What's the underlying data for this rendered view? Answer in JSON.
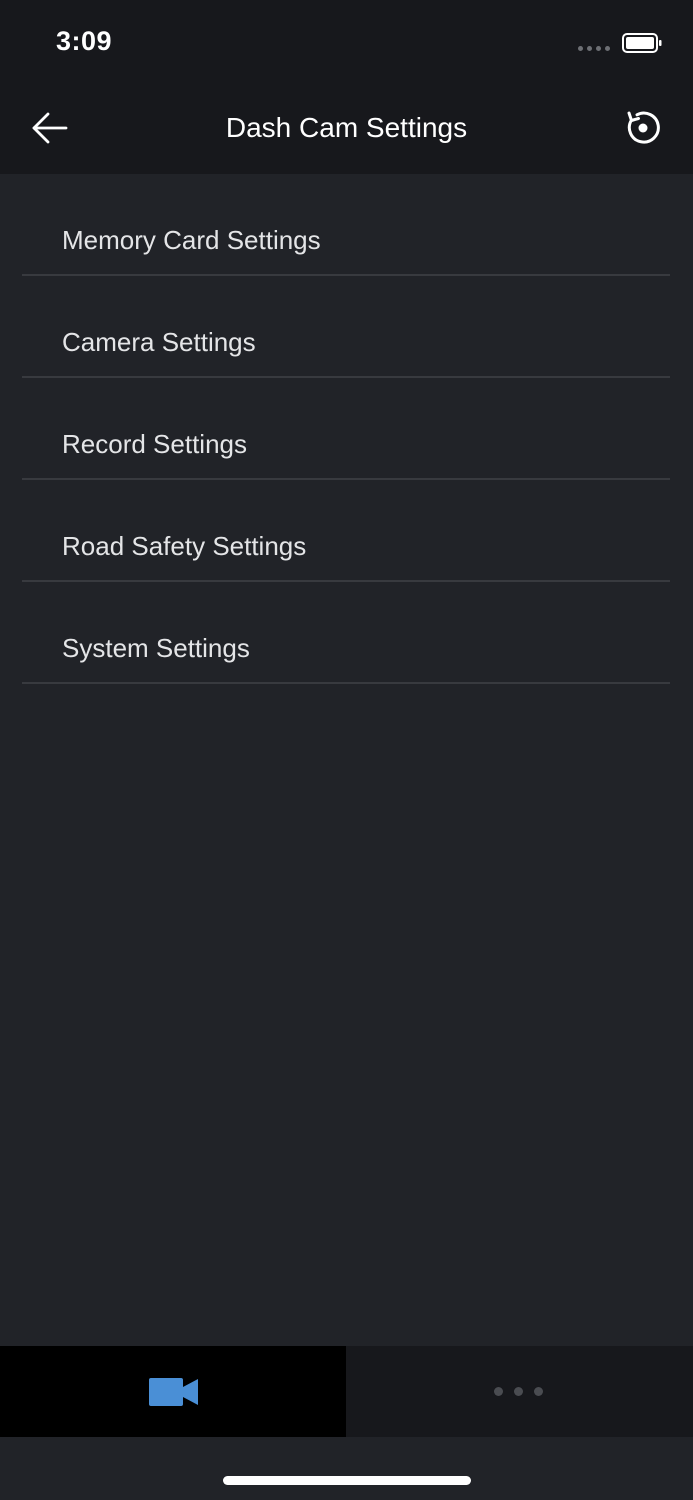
{
  "status_bar": {
    "time": "3:09"
  },
  "nav": {
    "title": "Dash Cam Settings",
    "back_icon": "arrow-left-icon",
    "reset_icon": "reset-circle-icon"
  },
  "settings": {
    "items": [
      {
        "label": "Memory Card Settings"
      },
      {
        "label": "Camera Settings"
      },
      {
        "label": "Record Settings"
      },
      {
        "label": "Road Safety Settings"
      },
      {
        "label": "System Settings"
      }
    ]
  },
  "tabs": {
    "dashcam_icon": "video-camera-icon",
    "more_icon": "more-dots-icon"
  },
  "colors": {
    "background": "#212328",
    "bar": "#17181c",
    "accent": "#4a8fd6",
    "divider": "#383a3f"
  }
}
